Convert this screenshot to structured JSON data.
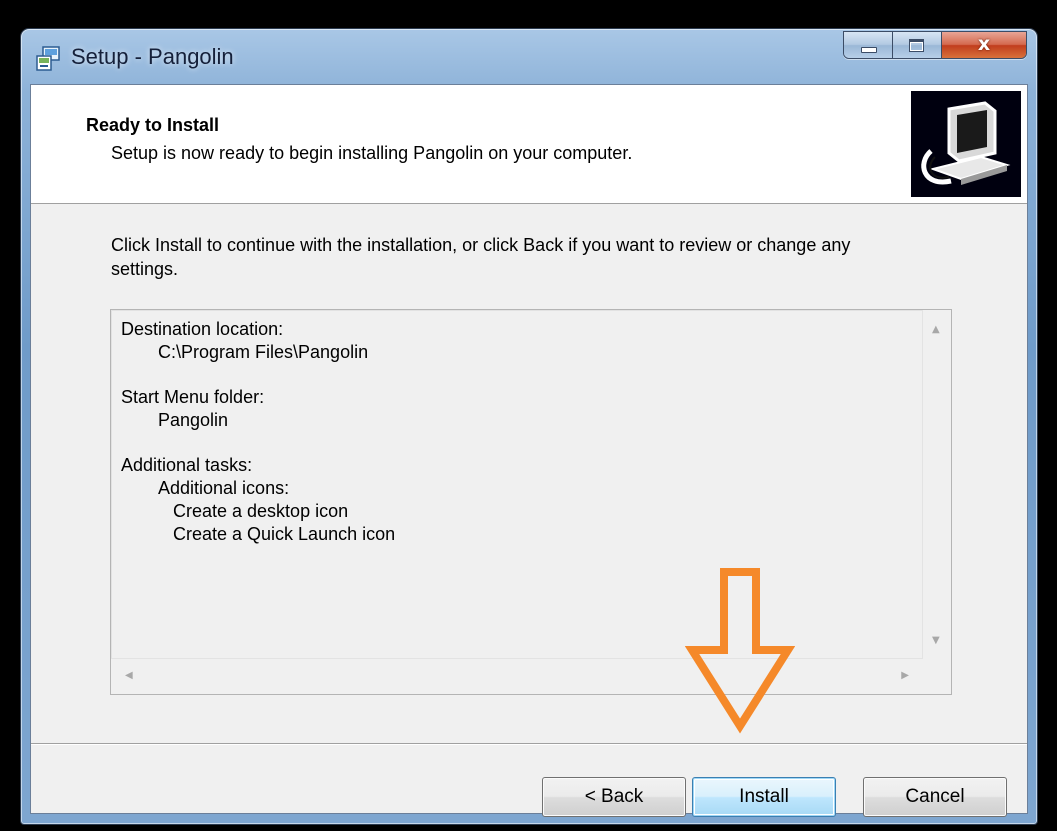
{
  "window": {
    "title": "Setup - Pangolin",
    "caption_buttons": {
      "close_label": "x"
    }
  },
  "header": {
    "heading": "Ready to Install",
    "subheading": "Setup is now ready to begin installing Pangolin on your computer."
  },
  "main": {
    "intro": "Click Install to continue with the installation, or click Back if you want to review or change any settings.",
    "memo": [
      {
        "text": "Destination location:",
        "indent": 0
      },
      {
        "text": "C:\\Program Files\\Pangolin",
        "indent": 1
      },
      {
        "text": "Start Menu folder:",
        "indent": 0
      },
      {
        "text": "Pangolin",
        "indent": 1
      },
      {
        "text": "Additional tasks:",
        "indent": 0
      },
      {
        "text": "Additional icons:",
        "indent": 1
      },
      {
        "text": "Create a desktop icon",
        "indent": 2
      },
      {
        "text": "Create a Quick Launch icon",
        "indent": 2
      }
    ]
  },
  "buttons": {
    "back": "< Back",
    "install": "Install",
    "cancel": "Cancel"
  },
  "colors": {
    "annotation_arrow": "#f5892a",
    "default_button_border": "#3c7fb1"
  },
  "icons": [
    "setup-app-icon",
    "installer-computer-icon",
    "scroll-up-icon",
    "scroll-down-icon",
    "scroll-left-icon",
    "scroll-right-icon",
    "annotation-down-arrow-icon"
  ]
}
